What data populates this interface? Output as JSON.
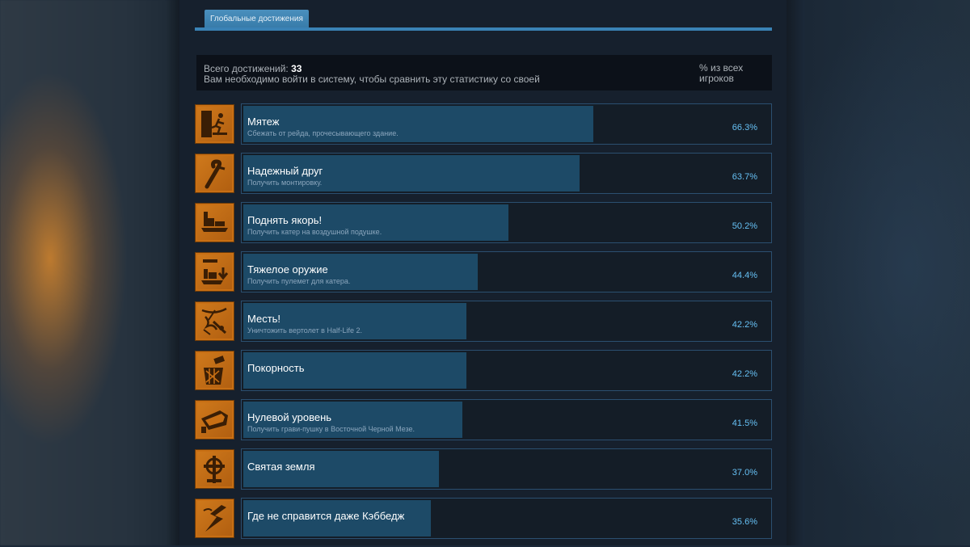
{
  "tab": {
    "label": "Глобальные достижения"
  },
  "summary": {
    "total_label": "Всего достижений:",
    "total_value": "33",
    "login_note": "Вам необходимо войти в систему, чтобы сравнить эту статистику со своей",
    "percent_header": "% из всех игроков"
  },
  "colors": {
    "accent": "#3a82b5",
    "bar_fill": "#1d4a67",
    "percent": "#66c0f4",
    "icon_bg": "#c86f14"
  },
  "achievements": [
    {
      "name": "Мятеж",
      "desc": "Сбежать от рейда, прочесывающего здание.",
      "percent": "66.3%",
      "value": 66.3,
      "icon": "running-man-door-icon"
    },
    {
      "name": "Надежный друг",
      "desc": "Получить монтировку.",
      "percent": "63.7%",
      "value": 63.7,
      "icon": "crowbar-icon"
    },
    {
      "name": "Поднять якорь!",
      "desc": "Получить катер на воздушной подушке.",
      "percent": "50.2%",
      "value": 50.2,
      "icon": "airboat-icon"
    },
    {
      "name": "Тяжелое оружие",
      "desc": "Получить пулемет для катера.",
      "percent": "44.4%",
      "value": 44.4,
      "icon": "airboat-gun-icon"
    },
    {
      "name": "Месть!",
      "desc": "Уничтожить вертолет в Half-Life 2.",
      "percent": "42.2%",
      "value": 42.2,
      "icon": "helicopter-crash-icon"
    },
    {
      "name": "Покорность",
      "desc": "",
      "percent": "42.2%",
      "value": 42.2,
      "icon": "trash-can-icon"
    },
    {
      "name": "Нулевой уровень",
      "desc": "Получить грави-пушку в Восточной Черной Мезе.",
      "percent": "41.5%",
      "value": 41.5,
      "icon": "gravity-gun-icon"
    },
    {
      "name": "Святая земля",
      "desc": "",
      "percent": "37.0%",
      "value": 37.0,
      "icon": "celtic-cross-icon"
    },
    {
      "name": "Где не справится даже Кэббедж",
      "desc": "",
      "percent": "35.6%",
      "value": 35.6,
      "icon": "lightning-icon"
    }
  ]
}
